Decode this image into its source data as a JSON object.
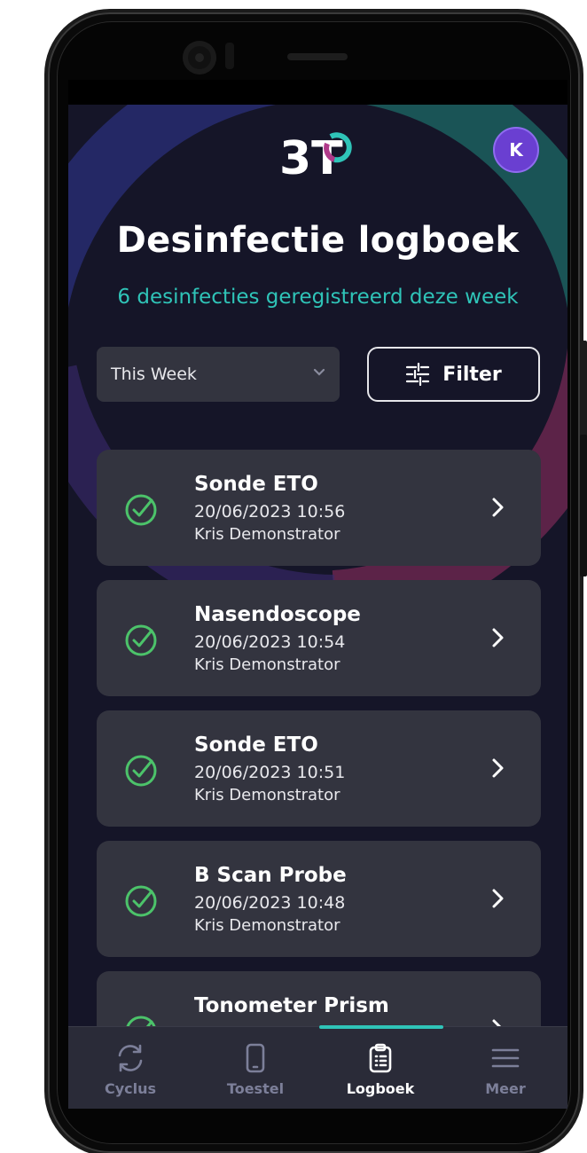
{
  "header": {
    "avatar_initial": "K",
    "title": "Desinfectie logboek",
    "subtitle": "6 desinfecties geregistreerd deze week"
  },
  "filters": {
    "period_selected": "This Week",
    "filter_label": "Filter"
  },
  "entries": [
    {
      "device": "Sonde ETO",
      "datetime": "20/06/2023 10:56",
      "user": "Kris Demonstrator"
    },
    {
      "device": "Nasendoscope",
      "datetime": "20/06/2023 10:54",
      "user": "Kris Demonstrator"
    },
    {
      "device": "Sonde ETO",
      "datetime": "20/06/2023 10:51",
      "user": "Kris Demonstrator"
    },
    {
      "device": "B Scan Probe",
      "datetime": "20/06/2023 10:48",
      "user": "Kris Demonstrator"
    },
    {
      "device": "Tonometer Prism",
      "datetime": "",
      "user": ""
    }
  ],
  "nav": {
    "items": [
      {
        "label": "Cyclus",
        "icon": "refresh-icon"
      },
      {
        "label": "Toestel",
        "icon": "device-icon"
      },
      {
        "label": "Logboek",
        "icon": "clipboard-icon"
      },
      {
        "label": "Meer",
        "icon": "menu-icon"
      }
    ],
    "active": "Logboek"
  },
  "colors": {
    "accent": "#2fc4b8",
    "check": "#4cc36a",
    "card": "#33343f",
    "background": "#151528",
    "avatar": "#6a3fd1"
  }
}
